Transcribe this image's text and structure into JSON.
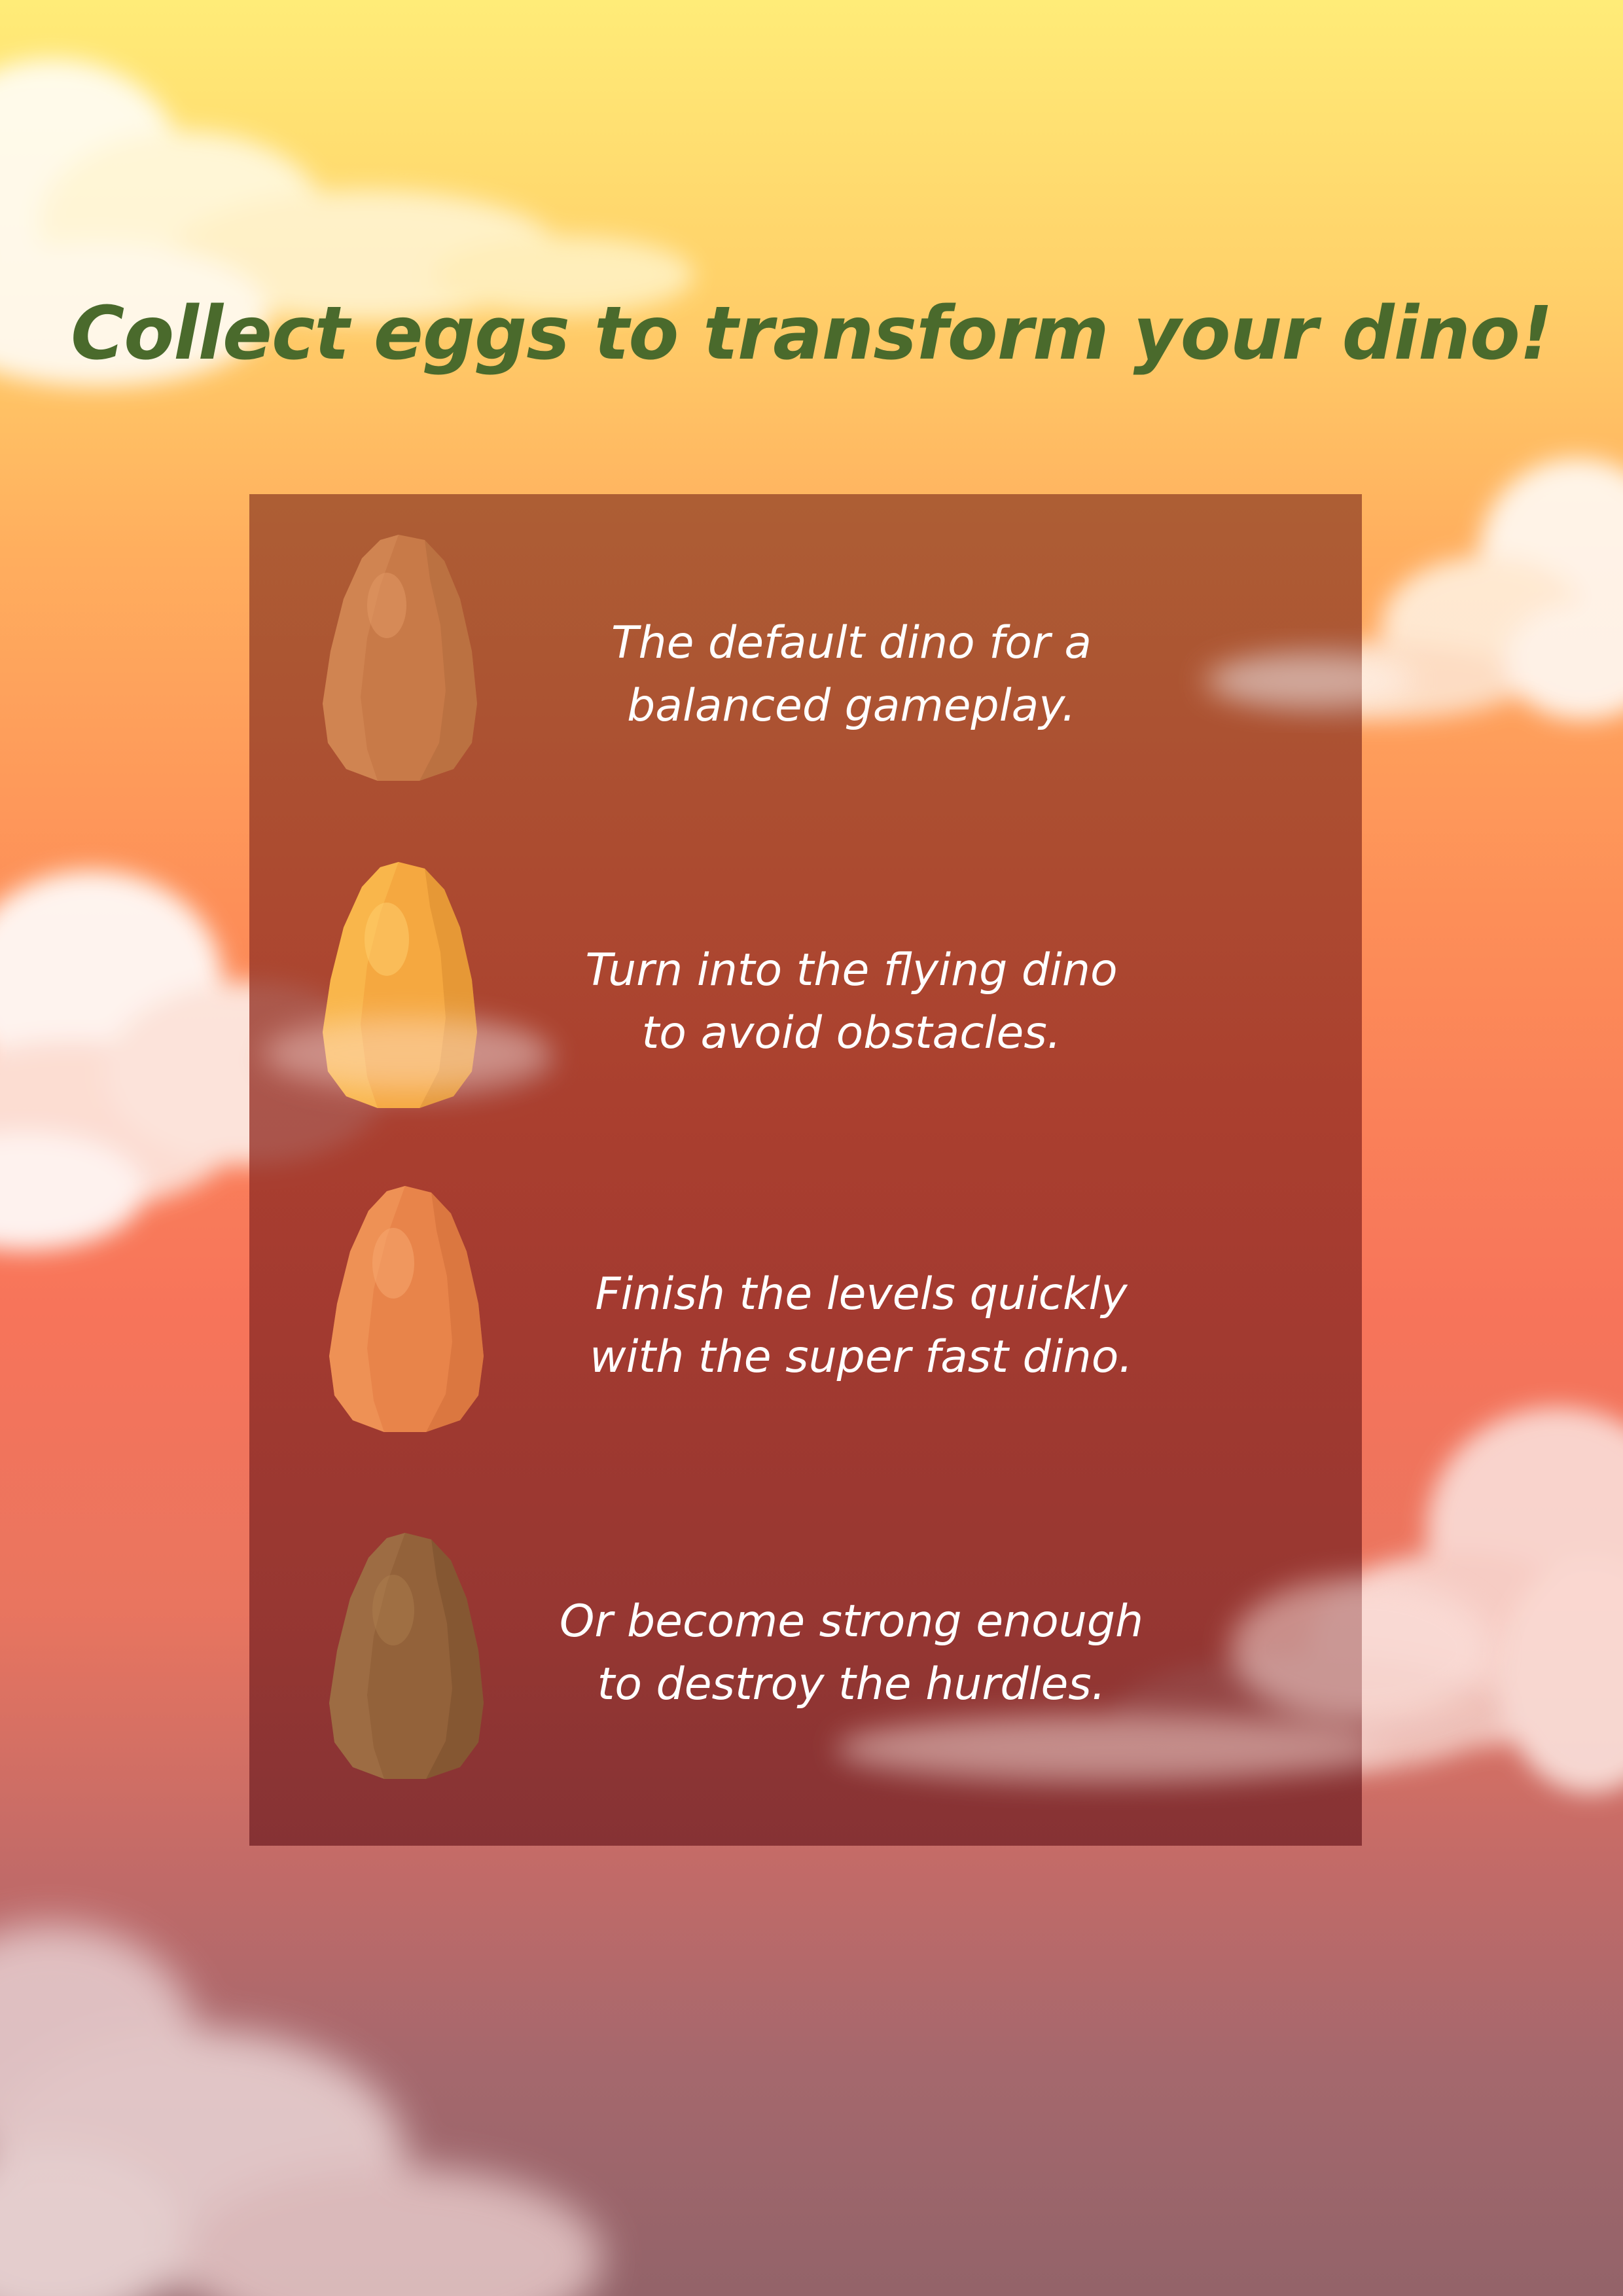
{
  "title": "Collect eggs to transform your dino!",
  "colors": {
    "title": "#4a6a2c",
    "panel": "#9a3a30",
    "text": "#ffffff"
  },
  "eggs": [
    {
      "icon": "brown-egg-icon",
      "color": "#c87a48",
      "line1": "The default dino for a",
      "line2": "balanced gameplay."
    },
    {
      "icon": "yellow-egg-icon",
      "color": "#f5a840",
      "line1": "Turn into the flying dino",
      "line2": "to avoid obstacles."
    },
    {
      "icon": "orange-egg-icon",
      "color": "#e8844a",
      "line1": "Finish the levels quickly",
      "line2": "with the super fast dino."
    },
    {
      "icon": "dark-brown-egg-icon",
      "color": "#93623a",
      "line1": "Or become strong enough",
      "line2": "to destroy the hurdles."
    }
  ]
}
